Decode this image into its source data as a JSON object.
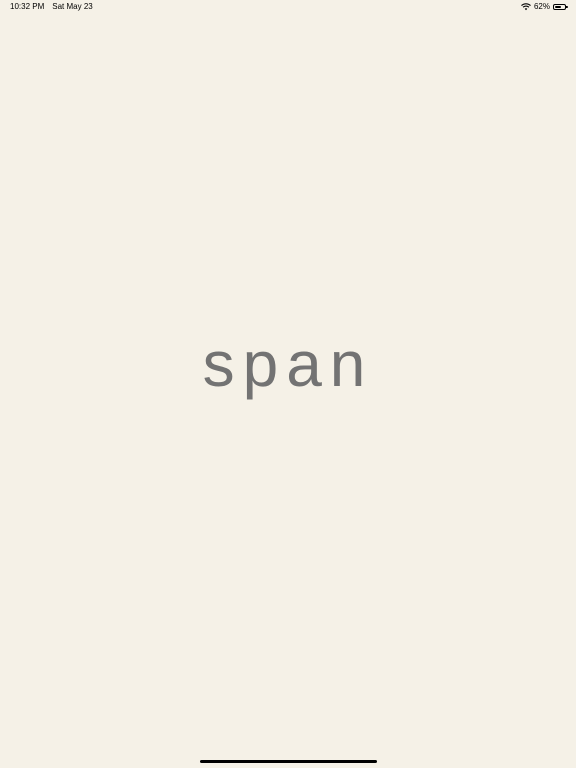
{
  "status_bar": {
    "time": "10:32 PM",
    "date": "Sat May 23",
    "battery_text": "62%",
    "battery_level": 0.62,
    "wifi_icon": "wifi-icon",
    "battery_icon": "battery-icon"
  },
  "splash": {
    "logo_text": "span",
    "logo_color": "#737373",
    "background_color": "#f5f1e7"
  }
}
